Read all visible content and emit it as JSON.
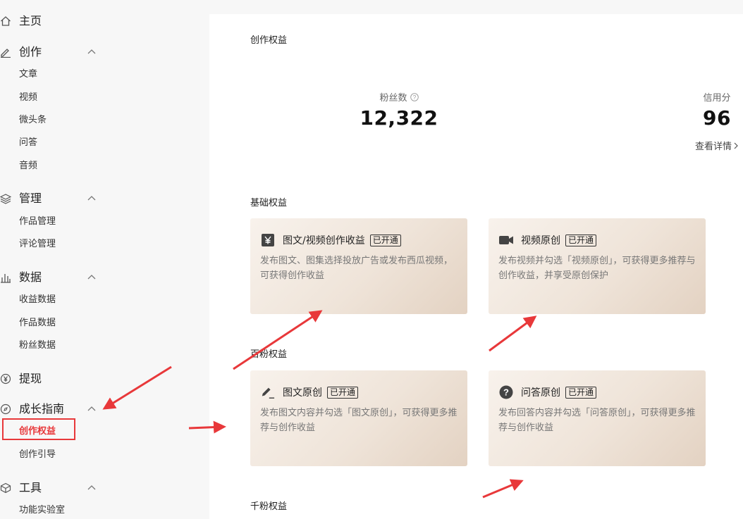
{
  "sidebar": {
    "groups": [
      {
        "label": "主页"
      },
      {
        "label": "创作",
        "items": [
          "文章",
          "视频",
          "微头条",
          "问答",
          "音频"
        ]
      },
      {
        "label": "管理",
        "items": [
          "作品管理",
          "评论管理"
        ]
      },
      {
        "label": "数据",
        "items": [
          "收益数据",
          "作品数据",
          "粉丝数据"
        ]
      },
      {
        "label": "提现"
      },
      {
        "label": "成长指南",
        "items": [
          "创作权益",
          "创作引导"
        ]
      },
      {
        "label": "工具",
        "items": [
          "功能实验室"
        ]
      }
    ],
    "active_item": "创作权益"
  },
  "main": {
    "title": "创作权益",
    "stats": {
      "fans_label": "粉丝数",
      "fans_value": "12,322",
      "credit_label": "信用分",
      "credit_value": "96",
      "detail_link": "查看详情"
    },
    "sections": [
      {
        "title": "基础权益",
        "cards": [
          {
            "title": "图文/视频创作收益",
            "badge": "已开通",
            "icon": "yen-icon",
            "desc": "发布图文、图集选择投放广告或发布西瓜视频，可获得创作收益"
          },
          {
            "title": "视频原创",
            "badge": "已开通",
            "icon": "video-camera-icon",
            "desc": "发布视频并勾选「视频原创」，可获得更多推荐与创作收益，并享受原创保护"
          }
        ]
      },
      {
        "title": "百粉权益",
        "cards": [
          {
            "title": "图文原创",
            "badge": "已开通",
            "icon": "pen-icon",
            "desc": "发布图文内容并勾选「图文原创」，可获得更多推荐与创作收益"
          },
          {
            "title": "问答原创",
            "badge": "已开通",
            "icon": "question-icon",
            "desc": "发布回答内容并勾选「问答原创」，可获得更多推荐与创作收益"
          }
        ]
      },
      {
        "title": "千粉权益"
      }
    ]
  },
  "colors": {
    "accent_red": "#e8383a",
    "sidebar_bg": "#f7f7f7",
    "card_gradient_start": "#f8f2ec",
    "card_gradient_end": "#e3d2c2"
  }
}
